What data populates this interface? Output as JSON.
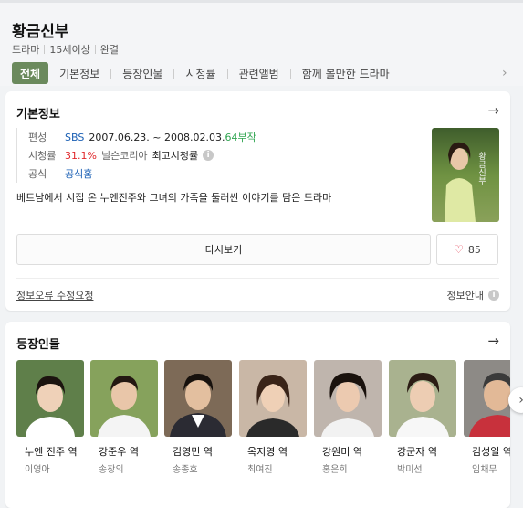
{
  "header": {
    "title": "황금신부",
    "meta": [
      "드라마",
      "15세이상",
      "완결"
    ],
    "tabs": [
      "전체",
      "기본정보",
      "등장인물",
      "시청률",
      "관련앨범",
      "함께 볼만한 드라마"
    ]
  },
  "basic": {
    "title": "기본정보",
    "rows": {
      "broadcast_label": "편성",
      "channel": "SBS",
      "period": "2007.06.23. ~ 2008.02.03.",
      "episodes": "64부작",
      "rating_label": "시청률",
      "rating_value": "31.1%",
      "rating_source": "닐슨코리아",
      "rating_type": "최고시청률",
      "official_label": "공식",
      "official_link": "공식홈"
    },
    "description": "베트남에서 시집 온 누엔진주와 그녀의 가족을 둘러싼 이야기를 담은 드라마",
    "replay_label": "다시보기",
    "like_count": "85",
    "report_label": "정보오류 수정요청",
    "guide_label": "정보안내"
  },
  "cast": {
    "title": "등장인물",
    "items": [
      {
        "role": "누엔 진주 역",
        "actor": "이영아"
      },
      {
        "role": "강준우 역",
        "actor": "송창의"
      },
      {
        "role": "김영민 역",
        "actor": "송종호"
      },
      {
        "role": "옥지영 역",
        "actor": "최여진"
      },
      {
        "role": "강원미 역",
        "actor": "홍은희"
      },
      {
        "role": "강군자 역",
        "actor": "박미선"
      },
      {
        "role": "김성일 역",
        "actor": "임채무"
      }
    ]
  },
  "colors": {
    "accent_tab": "#6b8a5d",
    "link_blue": "#1a5fb4",
    "episodes_green": "#2ea44f",
    "rating_red": "#e0262a",
    "heart": "#e23a4f"
  },
  "icons": {
    "tabs_next": "chevron-right-icon",
    "card_arrow": "arrow-right-icon",
    "like": "heart-icon",
    "info": "info-circle-icon",
    "scroll": "chevron-right-icon"
  }
}
